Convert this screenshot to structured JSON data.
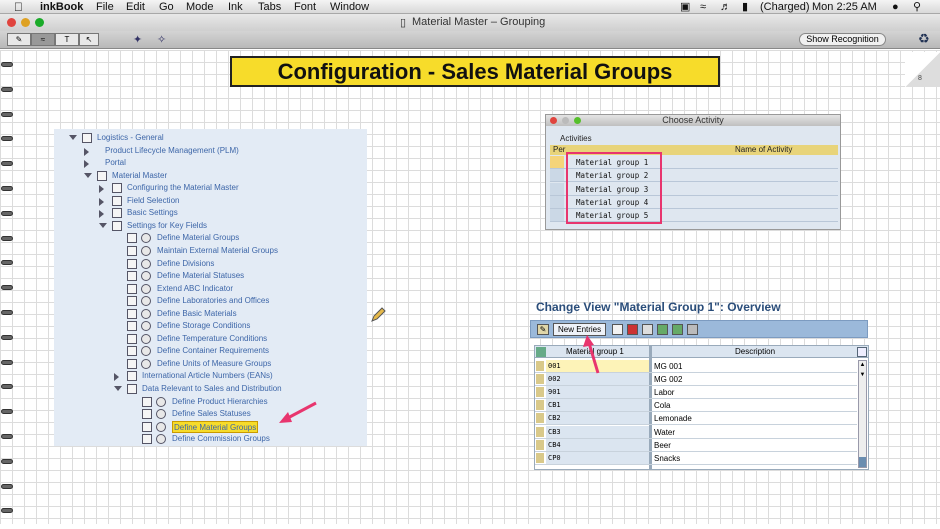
{
  "menubar": {
    "app_name": "inkBook",
    "items": [
      "File",
      "Edit",
      "Go",
      "Mode",
      "Ink",
      "Tabs",
      "Font",
      "Window"
    ],
    "battery": "(Charged)",
    "clock": "Mon 2:25 AM"
  },
  "window": {
    "title": "Material Master – Grouping",
    "show_recognition": "Show Recognition",
    "page_number": "8"
  },
  "banner": {
    "text": "Configuration - Sales Material Groups"
  },
  "tree": {
    "items": [
      {
        "label": "Logistics - General",
        "level": 0,
        "expander": "open",
        "icon": "folder"
      },
      {
        "label": "Product Lifecycle Management (PLM)",
        "level": 1,
        "expander": "closed",
        "icon": "none"
      },
      {
        "label": "Portal",
        "level": 1,
        "expander": "closed",
        "icon": "none"
      },
      {
        "label": "Material Master",
        "level": 1,
        "expander": "open",
        "icon": "folder"
      },
      {
        "label": "Configuring the Material Master",
        "level": 2,
        "expander": "closed",
        "icon": "doc"
      },
      {
        "label": "Field Selection",
        "level": 2,
        "expander": "closed",
        "icon": "doc"
      },
      {
        "label": "Basic Settings",
        "level": 2,
        "expander": "closed",
        "icon": "doc"
      },
      {
        "label": "Settings for Key Fields",
        "level": 2,
        "expander": "open",
        "icon": "doc"
      },
      {
        "label": "Define Material Groups",
        "level": 3,
        "expander": "none",
        "icon": "exec"
      },
      {
        "label": "Maintain External Material Groups",
        "level": 3,
        "expander": "none",
        "icon": "exec"
      },
      {
        "label": "Define Divisions",
        "level": 3,
        "expander": "none",
        "icon": "exec"
      },
      {
        "label": "Define Material Statuses",
        "level": 3,
        "expander": "none",
        "icon": "exec"
      },
      {
        "label": "Extend ABC Indicator",
        "level": 3,
        "expander": "none",
        "icon": "exec"
      },
      {
        "label": "Define Laboratories and Offices",
        "level": 3,
        "expander": "none",
        "icon": "exec"
      },
      {
        "label": "Define Basic Materials",
        "level": 3,
        "expander": "none",
        "icon": "exec"
      },
      {
        "label": "Define Storage Conditions",
        "level": 3,
        "expander": "none",
        "icon": "exec"
      },
      {
        "label": "Define Temperature Conditions",
        "level": 3,
        "expander": "none",
        "icon": "exec"
      },
      {
        "label": "Define Container Requirements",
        "level": 3,
        "expander": "none",
        "icon": "exec"
      },
      {
        "label": "Define Units of Measure Groups",
        "level": 3,
        "expander": "none",
        "icon": "exec"
      },
      {
        "label": "International Article Numbers (EANs)",
        "level": 3,
        "expander": "closed",
        "icon": "doc"
      },
      {
        "label": "Data Relevant to Sales and Distribution",
        "level": 3,
        "expander": "open",
        "icon": "doc"
      },
      {
        "label": "Define Product Hierarchies",
        "level": 4,
        "expander": "none",
        "icon": "exec"
      },
      {
        "label": "Define Sales Statuses",
        "level": 4,
        "expander": "none",
        "icon": "exec"
      },
      {
        "label": "Define Material Groups",
        "level": 4,
        "expander": "none",
        "icon": "exec",
        "selected": true
      },
      {
        "label": "Define Commission Groups",
        "level": 4,
        "expander": "none",
        "icon": "exec"
      }
    ]
  },
  "choose_activity": {
    "title": "Choose Activity",
    "tab": "Activities",
    "col_per": "Per",
    "col_name": "Name of Activity",
    "rows": [
      "Material group 1",
      "Material group 2",
      "Material group 3",
      "Material group 4",
      "Material group 5"
    ]
  },
  "change_view": {
    "title": "Change View \"Material Group 1\": Overview",
    "new_entries": "New Entries",
    "col_group": "Material group 1",
    "col_desc": "Description",
    "rows": [
      {
        "code": "001",
        "desc": "MG 001"
      },
      {
        "code": "002",
        "desc": "MG 002"
      },
      {
        "code": "901",
        "desc": "Labor"
      },
      {
        "code": "CB1",
        "desc": "Cola"
      },
      {
        "code": "CB2",
        "desc": "Lemonade"
      },
      {
        "code": "CB3",
        "desc": "Water"
      },
      {
        "code": "CB4",
        "desc": "Beer"
      },
      {
        "code": "CP0",
        "desc": "Snacks"
      }
    ]
  },
  "colors": {
    "banner": "#f7dc2a",
    "highlight": "#e8356e",
    "tree_text": "#3d66a8",
    "sap_blue": "#9bb9da"
  }
}
